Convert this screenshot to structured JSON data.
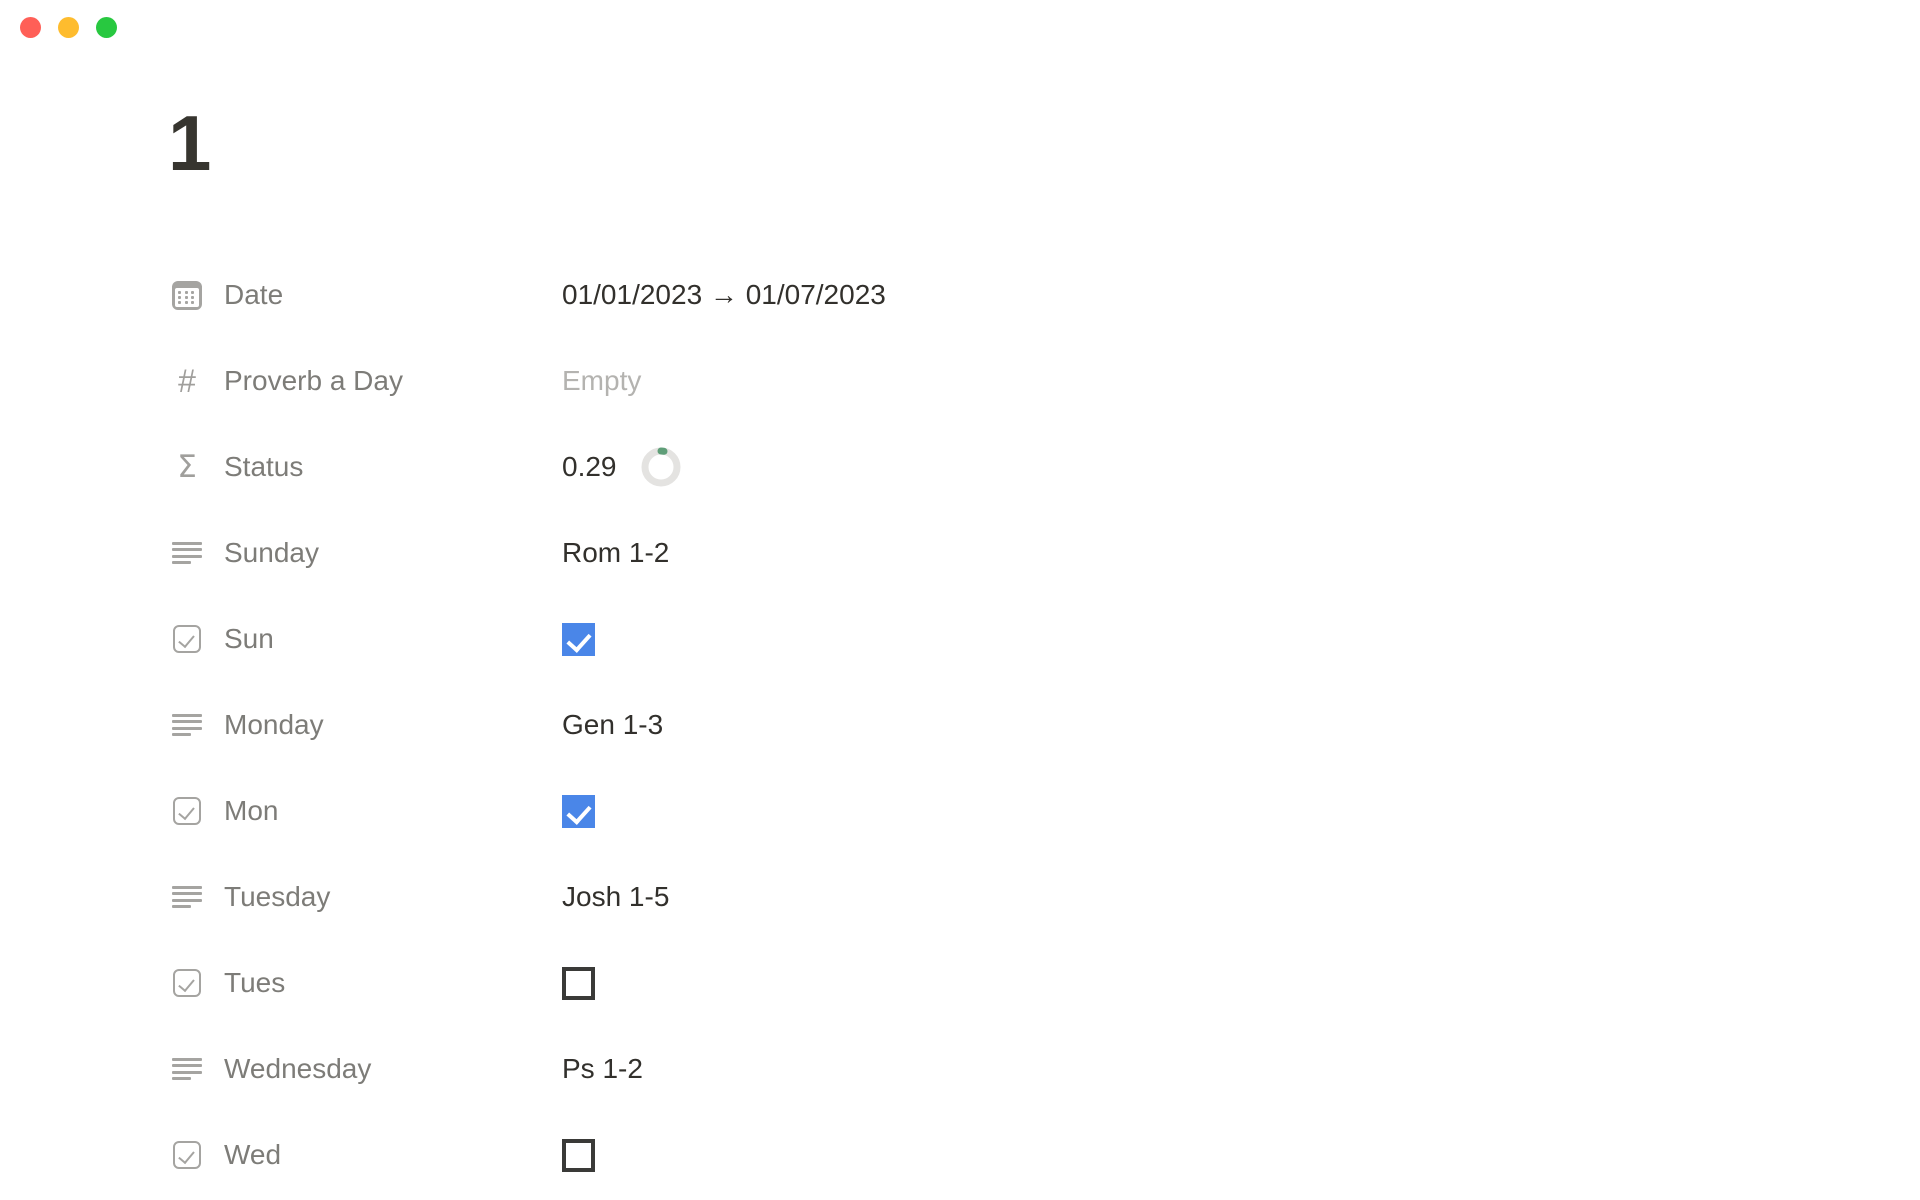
{
  "window": {
    "traffic_lights": [
      {
        "name": "close-button",
        "color": "#ff5f57"
      },
      {
        "name": "minimize-button",
        "color": "#febc2e"
      },
      {
        "name": "maximize-button",
        "color": "#28c840"
      }
    ]
  },
  "page": {
    "title": "1",
    "title_color": "#37352f"
  },
  "properties": [
    {
      "icon": "calendar-icon",
      "type": "date",
      "label": "Date",
      "value": "01/01/2023 → 01/07/2023",
      "empty": false
    },
    {
      "icon": "hash-icon",
      "type": "number",
      "label": "Proverb a Day",
      "value": "Empty",
      "empty": true
    },
    {
      "icon": "sigma-icon",
      "type": "rollup",
      "label": "Status",
      "value": "0.29",
      "empty": false,
      "progress": 0.29,
      "progress_track_color": "#e4e3e1",
      "progress_fill_color": "#5f9e78"
    },
    {
      "icon": "text-lines-icon",
      "type": "text",
      "label": "Sunday",
      "value": "Rom 1-2",
      "empty": false
    },
    {
      "icon": "checkbox-property-icon",
      "type": "checkbox",
      "label": "Sun",
      "checked": true
    },
    {
      "icon": "text-lines-icon",
      "type": "text",
      "label": "Monday",
      "value": "Gen 1-3",
      "empty": false
    },
    {
      "icon": "checkbox-property-icon",
      "type": "checkbox",
      "label": "Mon",
      "checked": true
    },
    {
      "icon": "text-lines-icon",
      "type": "text",
      "label": "Tuesday",
      "value": "Josh 1-5",
      "empty": false
    },
    {
      "icon": "checkbox-property-icon",
      "type": "checkbox",
      "label": "Tues",
      "checked": false
    },
    {
      "icon": "text-lines-icon",
      "type": "text",
      "label": "Wednesday",
      "value": "Ps 1-2",
      "empty": false
    },
    {
      "icon": "checkbox-property-icon",
      "type": "checkbox",
      "label": "Wed",
      "checked": false
    }
  ],
  "colors": {
    "checkbox_checked": "#4a86e8",
    "checkbox_unchecked_border": "#3a3a38",
    "label_text": "#7d7c78",
    "value_text": "#32302c",
    "empty_text": "#b4b3b0",
    "icon_gray": "#a5a4a1"
  }
}
